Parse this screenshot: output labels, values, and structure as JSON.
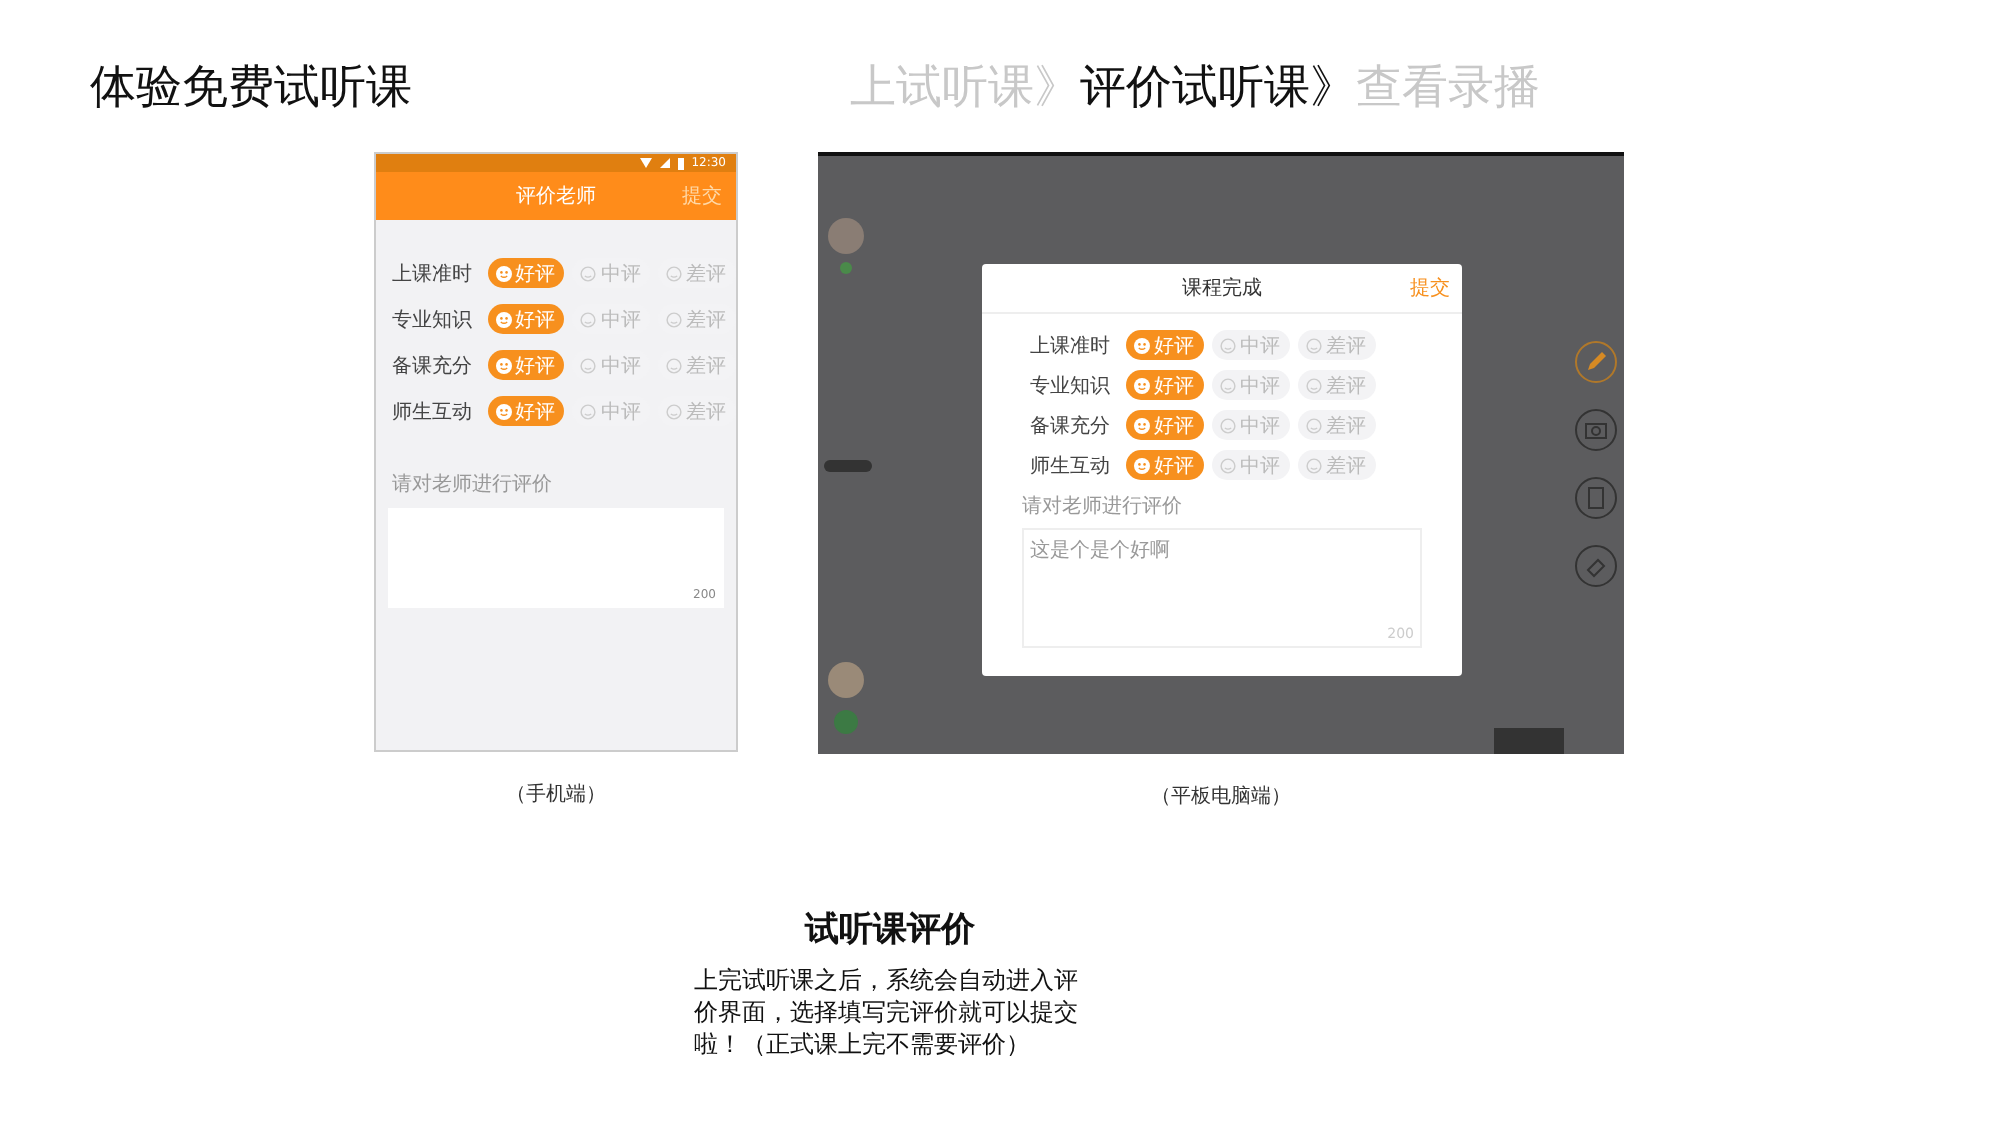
{
  "header": {
    "title": "体验免费试听课",
    "steps": [
      {
        "label": "上试听课》",
        "selected": false
      },
      {
        "label": "评价试听课》",
        "selected": true
      },
      {
        "label": "查看录播",
        "selected": false
      }
    ]
  },
  "phone": {
    "time": "12:30",
    "title": "评价老师",
    "submit": "提交",
    "ratings": [
      {
        "label": "上课准时",
        "options": [
          {
            "label": "好评",
            "selected": true
          },
          {
            "label": "中评",
            "selected": false
          },
          {
            "label": "差评",
            "selected": false
          }
        ]
      },
      {
        "label": "专业知识",
        "options": [
          {
            "label": "好评",
            "selected": true
          },
          {
            "label": "中评",
            "selected": false
          },
          {
            "label": "差评",
            "selected": false
          }
        ]
      },
      {
        "label": "备课充分",
        "options": [
          {
            "label": "好评",
            "selected": true
          },
          {
            "label": "中评",
            "selected": false
          },
          {
            "label": "差评",
            "selected": false
          }
        ]
      },
      {
        "label": "师生互动",
        "options": [
          {
            "label": "好评",
            "selected": true
          },
          {
            "label": "中评",
            "selected": false
          },
          {
            "label": "差评",
            "selected": false
          }
        ]
      }
    ],
    "comment_label": "请对老师进行评价",
    "counter": "200",
    "caption": "（手机端）"
  },
  "tablet": {
    "title": "课程完成",
    "submit": "提交",
    "ratings": [
      {
        "label": "上课准时",
        "options": [
          {
            "label": "好评",
            "selected": true
          },
          {
            "label": "中评",
            "selected": false
          },
          {
            "label": "差评",
            "selected": false
          }
        ]
      },
      {
        "label": "专业知识",
        "options": [
          {
            "label": "好评",
            "selected": true
          },
          {
            "label": "中评",
            "selected": false
          },
          {
            "label": "差评",
            "selected": false
          }
        ]
      },
      {
        "label": "备课充分",
        "options": [
          {
            "label": "好评",
            "selected": true
          },
          {
            "label": "中评",
            "selected": false
          },
          {
            "label": "差评",
            "selected": false
          }
        ]
      },
      {
        "label": "师生互动",
        "options": [
          {
            "label": "好评",
            "selected": true
          },
          {
            "label": "中评",
            "selected": false
          },
          {
            "label": "差评",
            "selected": false
          }
        ]
      }
    ],
    "comment_label": "请对老师进行评价",
    "comment_value": "这是个是个好啊",
    "counter": "200",
    "caption": "（平板电脑端）"
  },
  "note": {
    "title": "试听课评价",
    "text": "上完试听课之后，系统会自动进入评价界面，选择填写完评价就可以提交啦！（正式课上完不需要评价）"
  }
}
